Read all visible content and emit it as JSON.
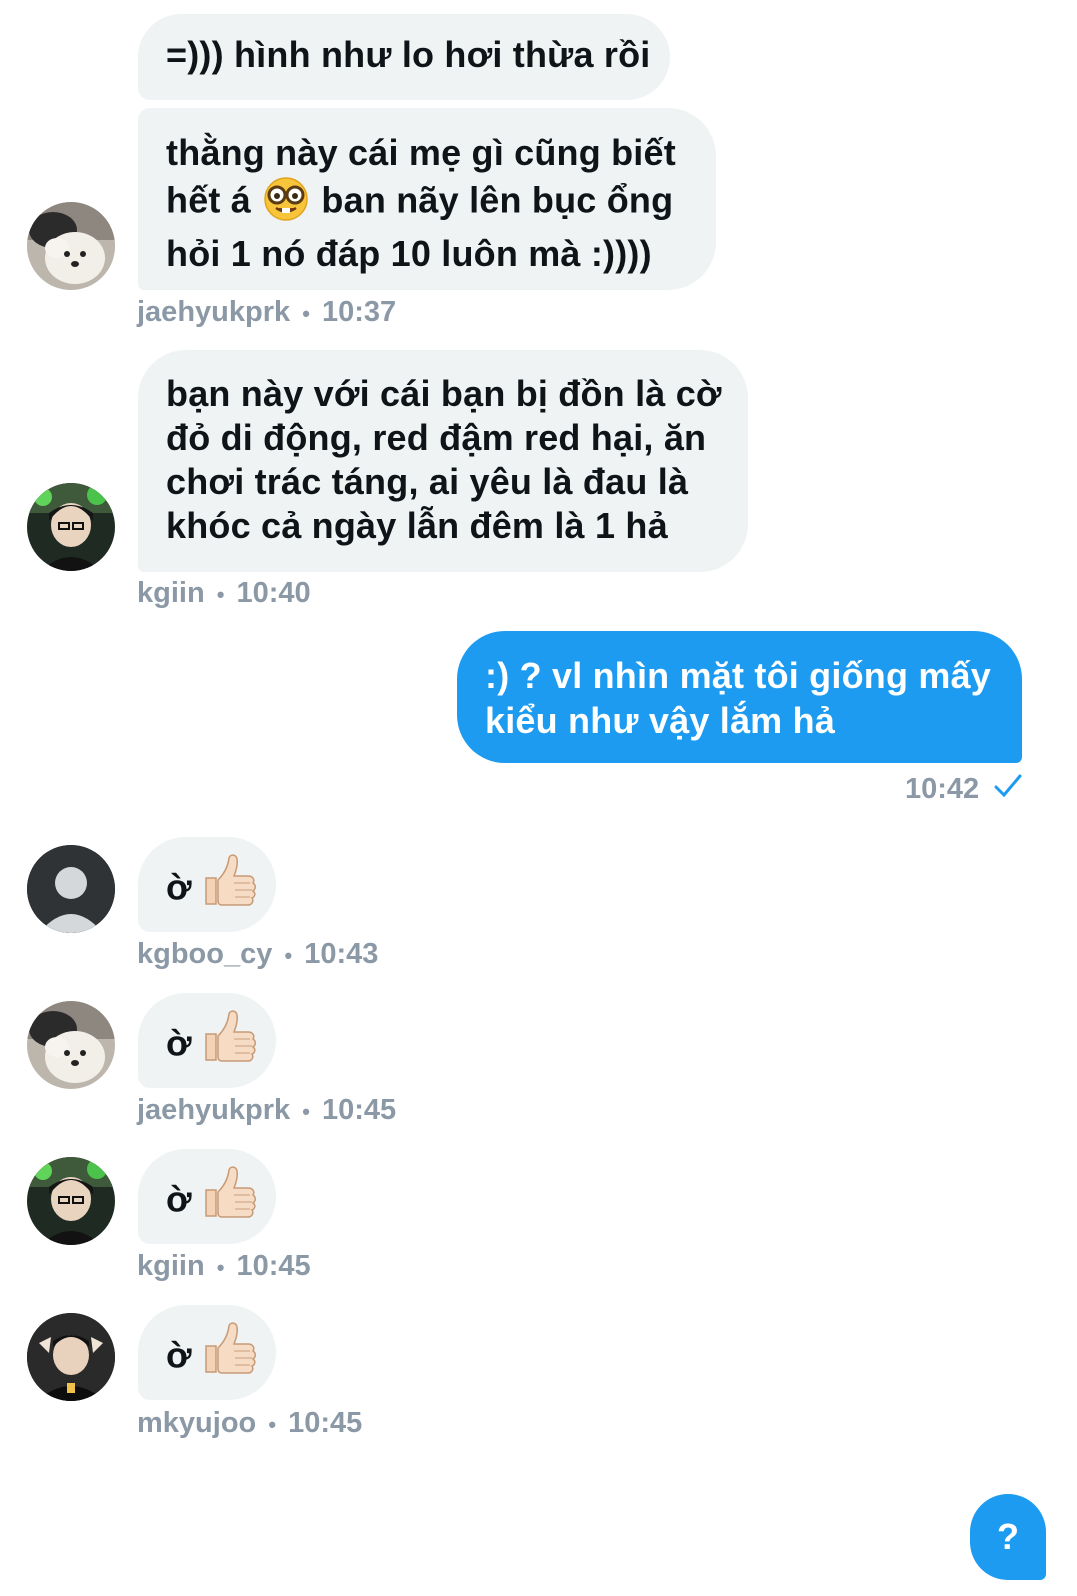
{
  "conversation": {
    "colors": {
      "incoming_bubble": "#eff3f4",
      "outgoing_bubble": "#1d9bf0",
      "meta_text": "#8b98a5"
    },
    "messages": [
      {
        "line1": "=))) hình như lo hơi thừa rồi"
      },
      {
        "line1": "thằng này cái mẹ gì cũng biết",
        "line2_pre": "hết á ",
        "line2_emoji": "nerd-face-emoji",
        "line2_post": " ban nãy lên bục ổng",
        "line3": "hỏi 1 nó đáp 10 luôn mà :))))",
        "sender": "jaehyukprk",
        "separator": "•",
        "time": "10:37"
      },
      {
        "line1": "bạn này với cái bạn bị đồn là cờ",
        "line2": "đỏ di động, red đậm red hại, ăn",
        "line3": "chơi trác táng, ai yêu là đau là",
        "line4": "khóc cả ngày lẫn đêm là 1 hả",
        "sender": "kgiin",
        "separator": "•",
        "time": "10:40"
      },
      {
        "line1": ":) ? vl nhìn mặt tôi giống mấy",
        "line2": "kiểu như vậy lắm hả",
        "time": "10:42",
        "status_icon": "read-check-icon"
      },
      {
        "text": "ờ",
        "emoji": "thumbs-up-emoji",
        "sender": "kgboo_cy",
        "separator": "•",
        "time": "10:43"
      },
      {
        "text": "ờ",
        "emoji": "thumbs-up-emoji",
        "sender": "jaehyukprk",
        "separator": "•",
        "time": "10:45"
      },
      {
        "text": "ờ",
        "emoji": "thumbs-up-emoji",
        "sender": "kgiin",
        "separator": "•",
        "time": "10:45"
      },
      {
        "text": "ờ",
        "emoji": "thumbs-up-emoji",
        "sender": "mkyujoo",
        "separator": "•",
        "time": "10:45"
      }
    ]
  },
  "fab": {
    "label": "?"
  }
}
